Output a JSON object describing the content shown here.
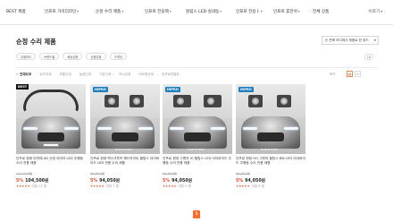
{
  "nav": {
    "items": [
      {
        "label": "BEST 제품",
        "caret": false
      },
      {
        "label": "인프로 가이더라인",
        "caret": true
      },
      {
        "label": "순정 수리 제품",
        "caret": true
      },
      {
        "label": "인프로 전용팩",
        "caret": true
      },
      {
        "label": "할립스 LED 실내등",
        "caret": true
      },
      {
        "label": "인프로 전용ㅏ",
        "caret": true
      },
      {
        "label": "인프로 휴먼쉬",
        "caret": true
      },
      {
        "label": "전체 상품",
        "caret": false
      }
    ],
    "right_label": "어로기"
  },
  "page_title": "순정 수리 제품",
  "sort": {
    "selected": "순 판매 모디에서 제품로 한 위드"
  },
  "filters": [
    "우회보도",
    "브랜드별",
    "배송유형",
    "상품유형",
    "가격대"
  ],
  "result_count": "13",
  "categories": {
    "active": "전체도보",
    "items": [
      "유오창계",
      "보통단계",
      "높음단계",
      "기본단계",
      "보수유형",
      "비트평유재",
      "한프로연통유"
    ]
  },
  "view": {
    "label": "보기",
    "grid_icon": "▦",
    "list_icon": "≡"
  },
  "products": [
    {
      "badge": "BEST",
      "name": "인프로 현대 아반떼 AD 순정 이어야 LED 주행등 수리 전용 제품",
      "original_price": "132,000원",
      "discount": "5%",
      "price": "104,500원",
      "stars": "★★★★★",
      "reviews": "리뷰 12 찜"
    },
    {
      "badge": "",
      "name": "인프로 현대 맥스크루즈 헤드라이트 할립스 아이바이드 LED 전용 수리 제품",
      "original_price": "99,800원",
      "discount": "5%",
      "price": "94,050원",
      "stars": "★★★★★",
      "reviews": "리뷰 7 찜"
    },
    {
      "badge": "",
      "name": "인프로 현대 그랜저 IG 할립스 LED 아이바이드 주행등 수리 전용 제품",
      "original_price": "99,800원",
      "discount": "5%",
      "price": "94,050원",
      "stars": "★★★★★",
      "reviews": "리뷰 9 찜"
    },
    {
      "badge": "",
      "name": "인프로 현대 HG 그랜저 할립스 8W LED 아이바이드 주행등 수리 전용 제품",
      "original_price": "99,800원",
      "discount": "5%",
      "price": "94,050원",
      "stars": "★★★★★",
      "reviews": "리뷰 8 찜"
    }
  ],
  "product_brand": "INPRO",
  "made_in": "MADE IN KOREA",
  "pagination": {
    "current": "1"
  },
  "colors": {
    "accent": "#ff6a2c",
    "discount": "#e24a2a",
    "star": "#e8522b"
  }
}
